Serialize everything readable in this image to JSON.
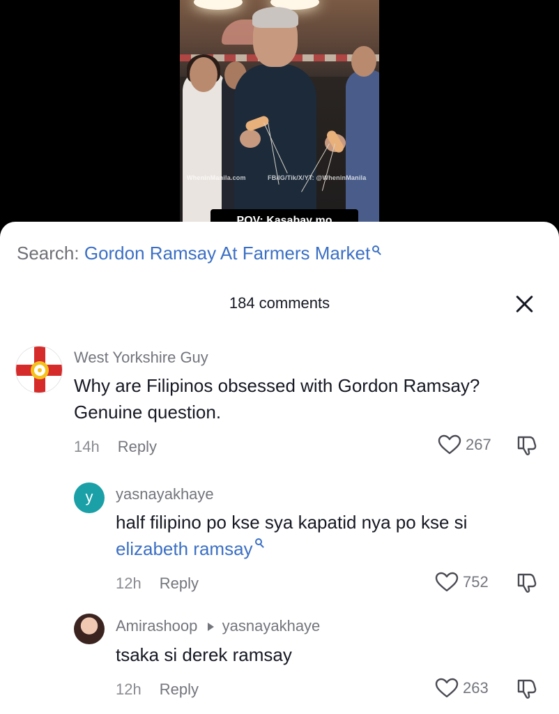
{
  "video": {
    "watermark_left": "WheninManila.com",
    "watermark_right": "FB/IG/Tik/X/YT: @WheninManila",
    "caption": "POV: Kasabay mo"
  },
  "search": {
    "label": "Search:",
    "query": "Gordon Ramsay At Farmers Market"
  },
  "comments_panel": {
    "count_label": "184 comments",
    "close_icon": "close-icon"
  },
  "comments": [
    {
      "author": "West Yorkshire Guy",
      "text": "Why are Filipinos obsessed with Gordon Ramsay? Genuine question.",
      "time": "14h",
      "reply_label": "Reply",
      "likes": "267"
    },
    {
      "author": "yasnayakhaye",
      "avatar_letter": "y",
      "text": "half filipino po kse sya kapatid nya po kse si",
      "link_text": "elizabeth ramsay",
      "time": "12h",
      "reply_label": "Reply",
      "likes": "752"
    },
    {
      "author": "Amirashoop",
      "reply_to": "yasnayakhaye",
      "text": "tsaka si derek ramsay",
      "time": "12h",
      "reply_label": "Reply",
      "likes": "263"
    }
  ],
  "colors": {
    "link": "#3b6fc4",
    "text": "#161823",
    "muted": "#73757c",
    "avatar_teal": "#1aa0a6"
  }
}
